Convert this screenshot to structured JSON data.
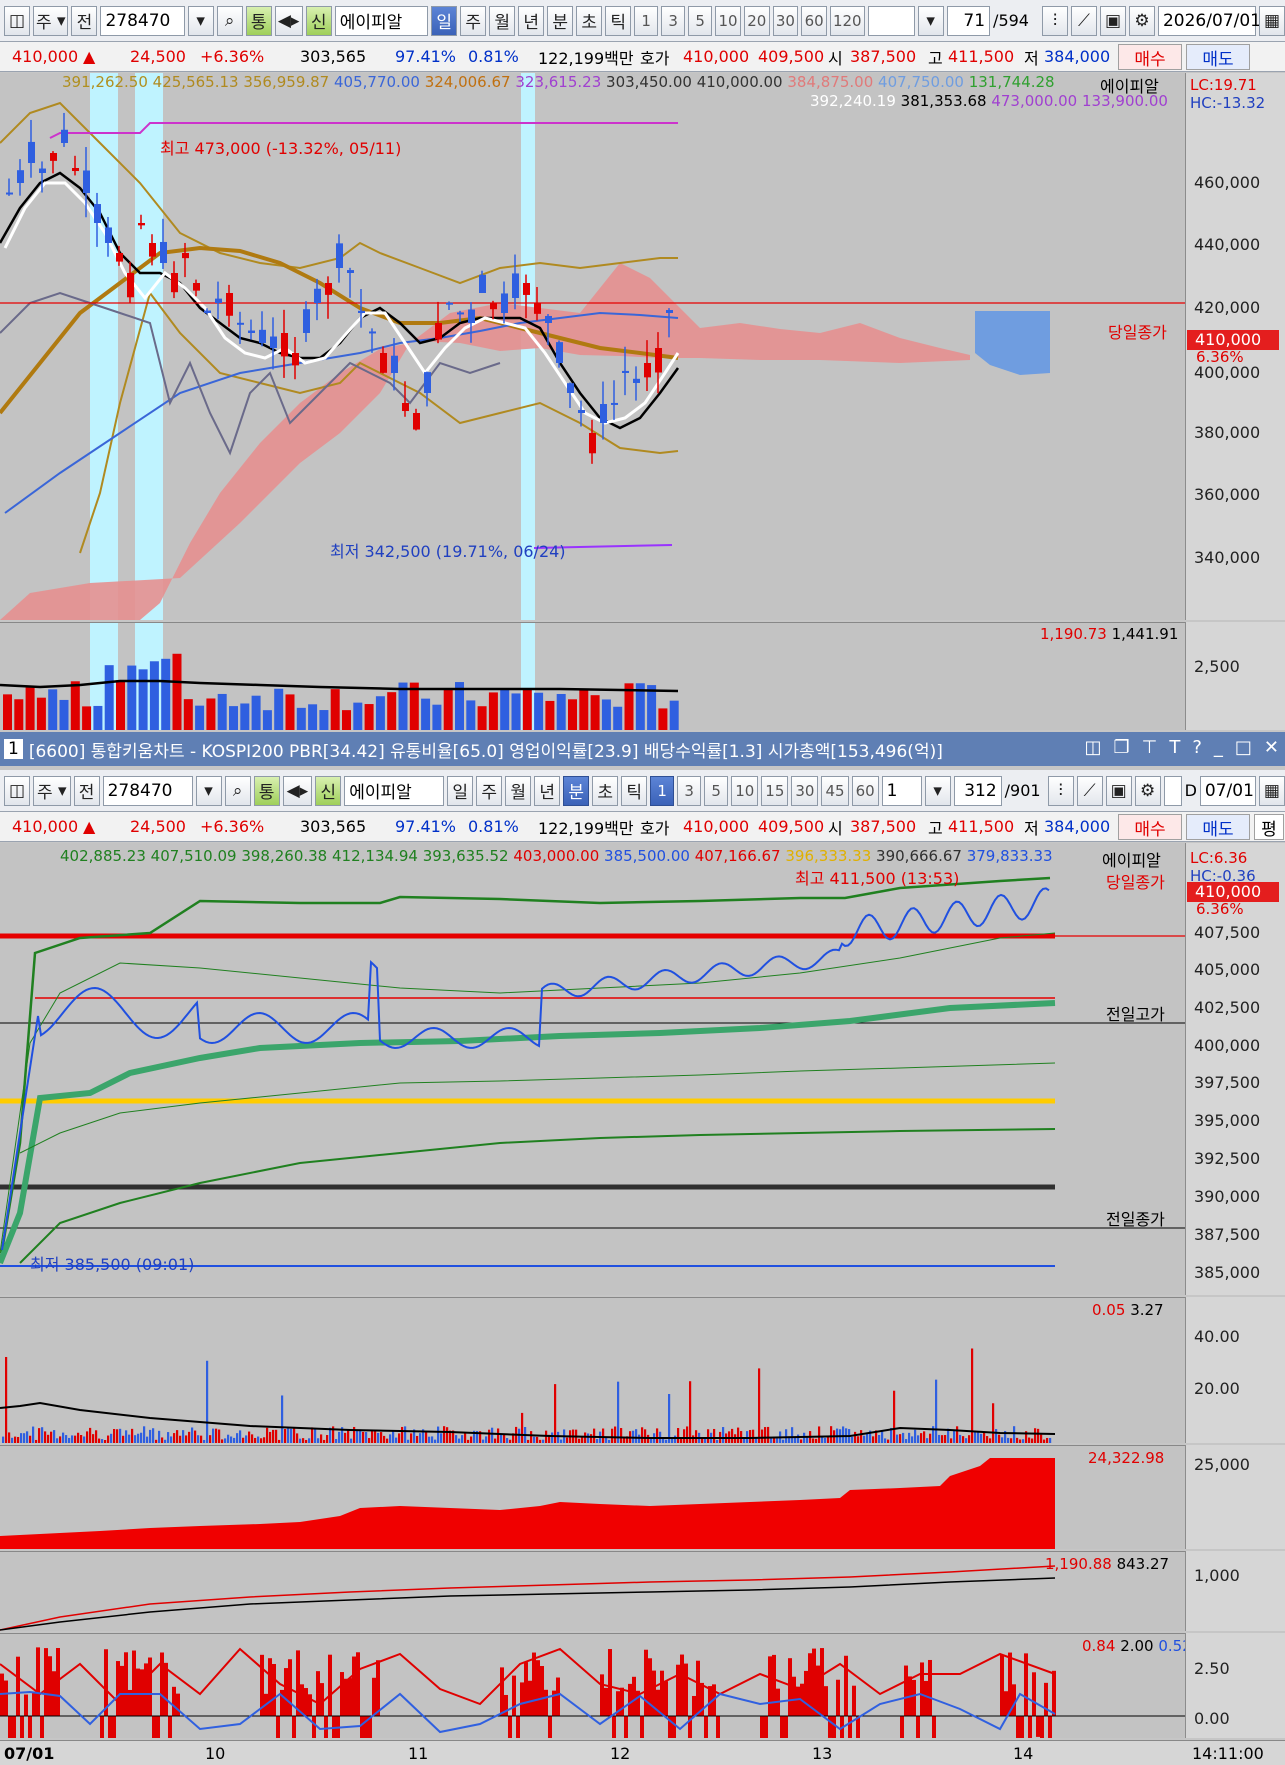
{
  "top": {
    "toolbar": {
      "type_selector": "주",
      "prev_label": "전",
      "code": "278470",
      "mode_tong": "통",
      "shin": "신",
      "stock_name": "에이피알",
      "periods": [
        "일",
        "주",
        "월",
        "년",
        "분",
        "초",
        "틱"
      ],
      "selected_period": "일",
      "intervals": [
        "1",
        "3",
        "5",
        "10",
        "20",
        "30",
        "60",
        "120"
      ],
      "count": "71",
      "total": "/594",
      "date": "2026/07/01"
    },
    "quote": {
      "price": "410,000",
      "arrow": "▲",
      "change": "24,500",
      "pct": "+6.36%",
      "volume": "303,565",
      "ratio": "97.41%",
      "turnover": "0.81%",
      "amount": "122,199백만",
      "hoga_label": "호가",
      "bid": "410,000",
      "ask": "409,500",
      "open_label": "시",
      "open": "387,500",
      "high_label": "고",
      "high": "411,500",
      "low_label": "저",
      "low": "384,000",
      "buy": "매수",
      "sell": "매도"
    },
    "legend1": [
      "391,262.50",
      "425,565.13",
      "356,959.87",
      "405,770.00",
      "324,006.67",
      "323,615.23",
      "303,450.00",
      "410,000.00",
      "384,875.00",
      "407,750.00",
      "131,744.28"
    ],
    "legend1_name": "에이피알",
    "legend2": [
      "392,240.19",
      "381,353.68",
      "473,000.00",
      "133,900.00"
    ],
    "lc": "LC:19.71",
    "hc": "HC:-13.32",
    "max_note": "최고 473,000 (-13.32%, 05/11)",
    "min_note": "최저 342,500 (19.71%, 06/24)",
    "close_label": "당일종가",
    "close_price": "410,000",
    "close_pct": "6.36%",
    "ticks": [
      "460,000",
      "440,000",
      "420,000",
      "400,000",
      "380,000",
      "360,000",
      "340,000"
    ],
    "vol_legend": [
      "1,190.73",
      "1,441.91"
    ],
    "vol_tick": "2,500"
  },
  "window": {
    "id": "1",
    "title": "[6600] 통합키움차트 - KOSPI200 PBR[34.42] 유통비율[65.0] 영업이익률[23.9] 배당수익률[1.3] 시가총액[153,496(억)]"
  },
  "bottom": {
    "toolbar": {
      "type_selector": "주",
      "prev_label": "전",
      "code": "278470",
      "mode_tong": "통",
      "shin": "신",
      "stock_name": "에이피알",
      "periods": [
        "일",
        "주",
        "월",
        "년",
        "분",
        "초",
        "틱"
      ],
      "selected_period": "분",
      "intervals": [
        "1",
        "3",
        "5",
        "10",
        "15",
        "30",
        "45",
        "60"
      ],
      "selected_interval": "1",
      "unit": "1",
      "count": "312",
      "total": "/901",
      "date": "07/01"
    },
    "quote": {
      "price": "410,000",
      "arrow": "▲",
      "change": "24,500",
      "pct": "+6.36%",
      "volume": "303,565",
      "ratio": "97.41%",
      "turnover": "0.81%",
      "amount": "122,199백만",
      "hoga_label": "호가",
      "bid": "410,000",
      "ask": "409,500",
      "open_label": "시",
      "open": "387,500",
      "high_label": "고",
      "high": "411,500",
      "low_label": "저",
      "low": "384,000",
      "buy": "매수",
      "sell": "매도",
      "extra": "평"
    },
    "legend": [
      "402,885.23",
      "407,510.09",
      "398,260.38",
      "412,134.94",
      "393,635.52",
      "403,000.00",
      "385,500.00",
      "407,166.67",
      "396,333.33",
      "390,666.67",
      "379,833.33"
    ],
    "legend_name": "에이피알",
    "lc": "LC:6.36",
    "hc": "HC:-0.36",
    "max_note": "최고 411,500 (13:53)",
    "min_note": "최저 385,500 (09:01)",
    "close_label": "당일종가",
    "prev_high_label": "전일고가",
    "prev_close_label": "전일종가",
    "close_price": "410,000",
    "close_pct": "6.36%",
    "ticks": [
      "407,500",
      "405,000",
      "402,500",
      "400,000",
      "397,500",
      "395,000",
      "392,500",
      "390,000",
      "387,500",
      "385,000"
    ],
    "vol_legend": [
      "0.05",
      "3.27"
    ],
    "vol_ticks": [
      "40.00",
      "20.00"
    ],
    "cum_legend": "24,322.98",
    "cum_tick": "25,000",
    "ind1_legend": [
      "1,190.88",
      "843.27"
    ],
    "ind1_tick": "1,000",
    "ind2_legend": [
      "0.84",
      "2.00",
      "0.52"
    ],
    "ind2_ticks": [
      "2.50",
      "0.00"
    ],
    "time_labels": [
      "07/01",
      "10",
      "11",
      "12",
      "13",
      "14"
    ],
    "clock": "14:11:00"
  },
  "colors": {
    "up": "#e00000",
    "down": "#2f5fe0",
    "cloud": "#e59090",
    "bg": "#c3c3c3"
  }
}
